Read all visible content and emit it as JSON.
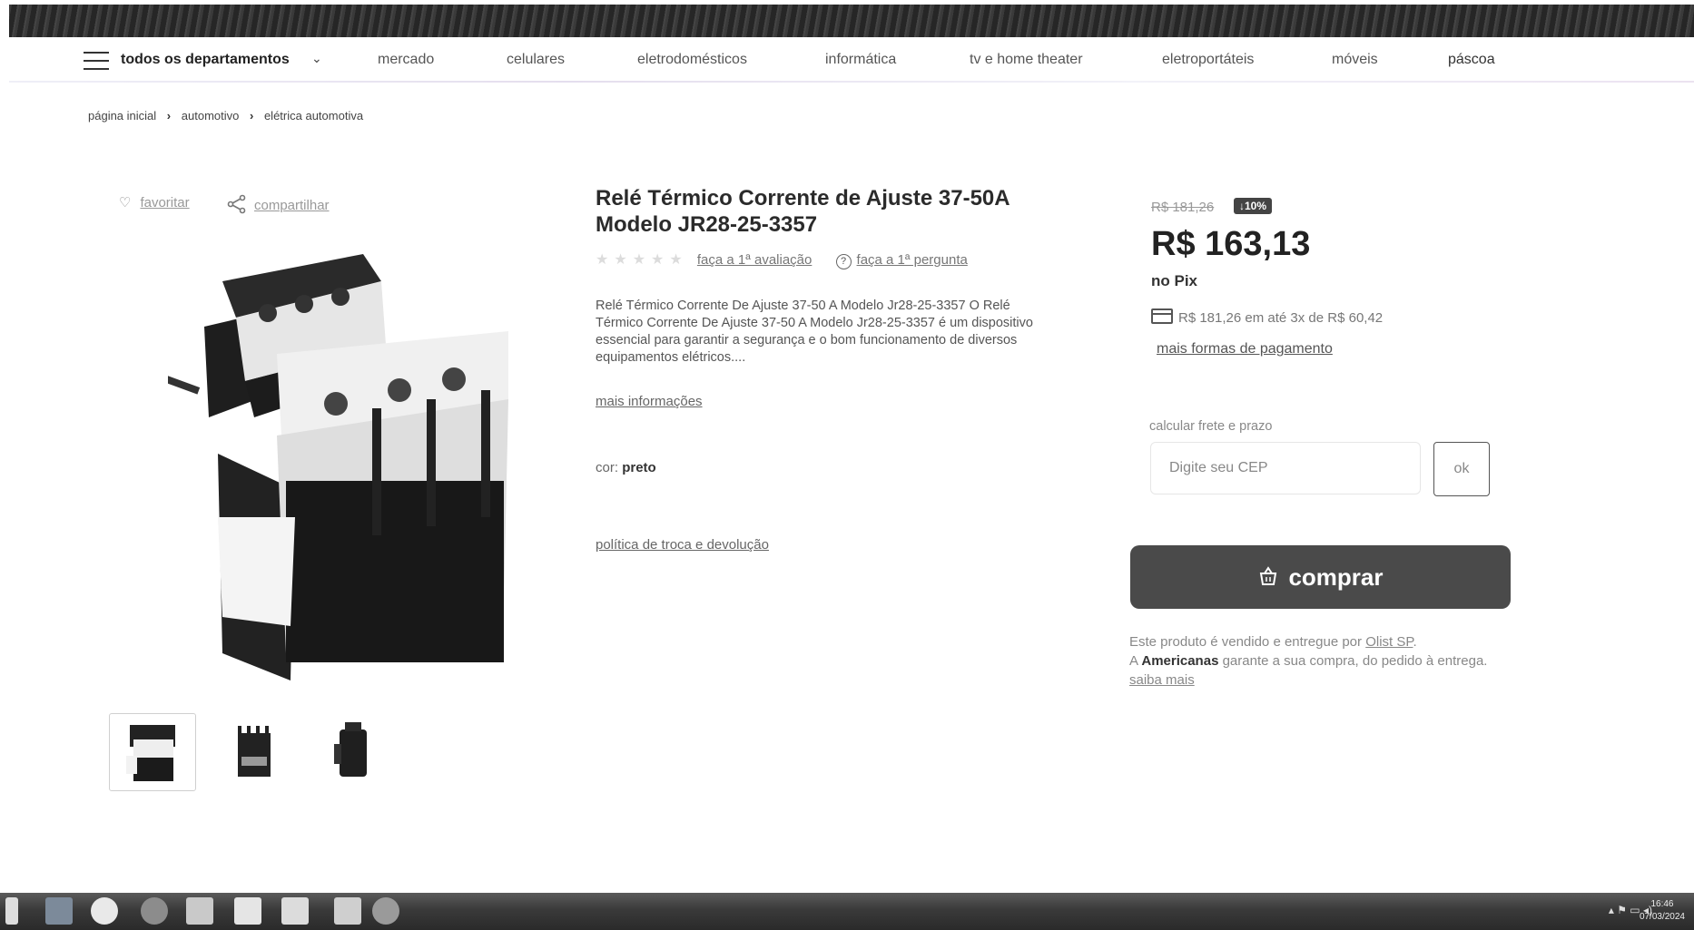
{
  "nav": {
    "departments": "todos os departamentos",
    "items": [
      "mercado",
      "celulares",
      "eletrodomésticos",
      "informática",
      "tv e home theater",
      "eletroportáteis",
      "móveis",
      "páscoa"
    ]
  },
  "breadcrumb": [
    "página inicial",
    "automotivo",
    "elétrica automotiva"
  ],
  "actions": {
    "favorite": "favoritar",
    "share": "compartilhar"
  },
  "product": {
    "title": "Relé Térmico Corrente de Ajuste 37-50A Modelo JR28-25-3357",
    "rating_link": "faça a 1ª avaliação",
    "question_link": "faça a 1ª pergunta",
    "description": "Relé Térmico Corrente De Ajuste 37-50 A Modelo Jr28-25-3357 O Relé Térmico Corrente De Ajuste 37-50 A Modelo Jr28-25-3357 é um dispositivo essencial para garantir a segurança e o bom funcionamento de diversos equipamentos elétricos....",
    "more_info": "mais informações",
    "color_label": "cor:",
    "color_value": "preto",
    "policy": "política de troca e devolução"
  },
  "price": {
    "old": "R$ 181,26",
    "discount": "↓10%",
    "current": "R$ 163,13",
    "pix": "no Pix",
    "installments": "R$ 181,26 em até 3x de R$ 60,42",
    "more_payment": "mais formas de pagamento"
  },
  "shipping": {
    "label": "calcular frete e prazo",
    "placeholder": "Digite seu CEP",
    "ok": "ok"
  },
  "buy_label": "comprar",
  "seller": {
    "line1_prefix": "Este produto é vendido e entregue por",
    "seller_name": "Olist SP",
    "line2_prefix": "A",
    "brand": "Americanas",
    "line2_suffix": "garante a sua compra, do pedido à entrega.",
    "more": "saiba mais"
  },
  "taskbar": {
    "time": "16:46",
    "date": "07/03/2024"
  },
  "colors": {
    "buy_button": "#4a4a4a",
    "badge": "#444444"
  }
}
